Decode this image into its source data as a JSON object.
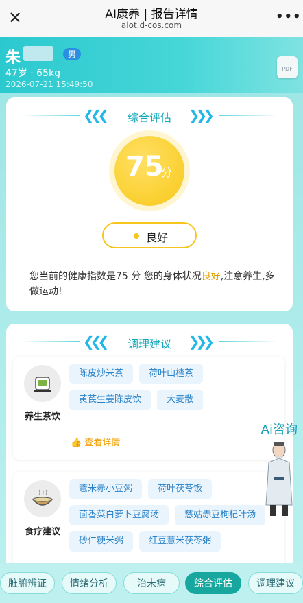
{
  "topbar": {
    "close_icon": "close-icon",
    "title": "AI康养 | 报告详情",
    "url": "aiot.d-cos.com",
    "more_icon": "more-icon"
  },
  "header": {
    "name": "朱",
    "gender": "男",
    "age_weight": "47岁 · 65kg",
    "datetime": "2026-07-21 15:49:50",
    "pdf_label": "PDF"
  },
  "overall": {
    "section_title": "综合评估",
    "score": "75",
    "score_unit": "分",
    "status": "良好",
    "summary_before": "您当前的健康指数是75 分 您的身体状况",
    "summary_highlight": "良好",
    "summary_after": ",注意养生,多做运动!"
  },
  "advice": {
    "section_title": "调理建议",
    "items": [
      {
        "label": "养生茶饮",
        "tags": [
          "陈皮炒米茶",
          "荷叶山楂茶",
          "黄芪生姜陈皮饮",
          "大麦散"
        ],
        "link": "查看详情"
      },
      {
        "label": "食疗建议",
        "tags": [
          "薏米赤小豆粥",
          "荷叶茯苓饭",
          "茴香菜白萝卜豆腐汤",
          "慈姑赤豆枸杞叶汤",
          "砂仁粳米粥",
          "红豆薏米茯苓粥"
        ]
      }
    ]
  },
  "ai": {
    "label": "Ai咨询"
  },
  "tabs": [
    "脏腑辨证",
    "情绪分析",
    "治未病",
    "综合评估",
    "调理建议"
  ],
  "active_tab": "综合评估",
  "colors": {
    "accent": "#17a79f",
    "score": "#f6c61c",
    "tag_text": "#2a82c7"
  }
}
